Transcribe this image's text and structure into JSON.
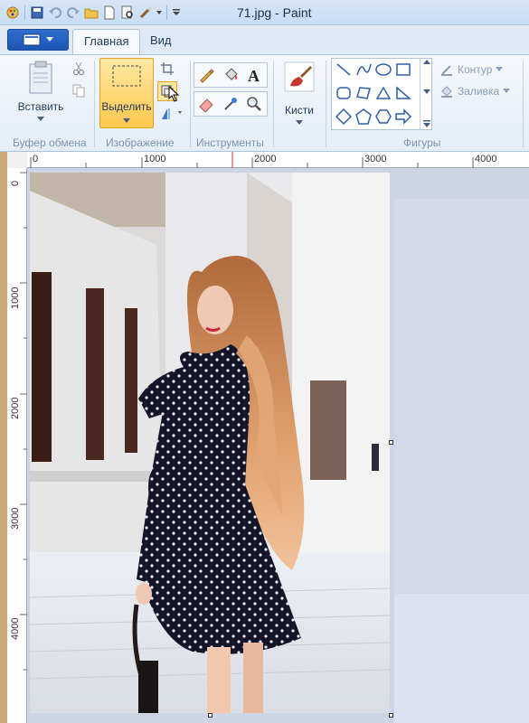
{
  "window": {
    "title": "71.jpg - Paint"
  },
  "tabs": [
    {
      "label": "Главная",
      "active": true
    },
    {
      "label": "Вид",
      "active": false
    }
  ],
  "clipboard": {
    "paste_label": "Вставить",
    "group_label": "Буфер обмена"
  },
  "image_group": {
    "select_label": "Выделить",
    "group_label": "Изображение"
  },
  "tools_group": {
    "group_label": "Инструменты"
  },
  "brushes": {
    "label": "Кисти"
  },
  "shapes_group": {
    "group_label": "Фигуры",
    "outline_label": "Контур",
    "fill_label": "Заливка"
  },
  "ruler": {
    "horizontal": [
      "0",
      "1000",
      "2000",
      "3000",
      "4000"
    ],
    "vertical": [
      "0",
      "1000",
      "2000",
      "3000",
      "4000"
    ]
  },
  "colors": {
    "accent": "#1e56b3",
    "select_active": "#ffc84f",
    "ribbon_text": "#1e395b"
  }
}
